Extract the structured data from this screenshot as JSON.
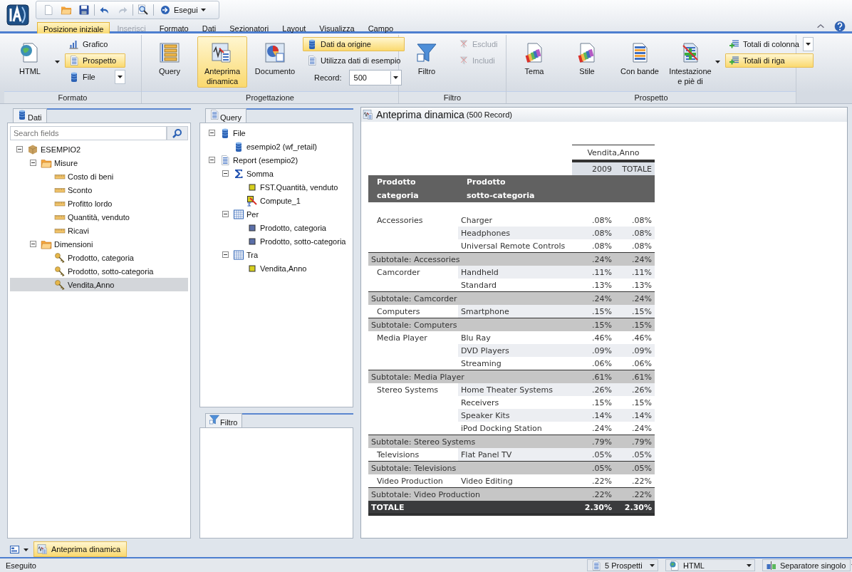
{
  "quick_toolbar": {
    "run_label": "Esegui"
  },
  "menu_tabs": [
    {
      "label": "Posizione iniziale",
      "selected": true,
      "disabled": false
    },
    {
      "label": "Inserisci",
      "selected": false,
      "disabled": true
    },
    {
      "label": "Formato",
      "selected": false,
      "disabled": false
    },
    {
      "label": "Dati",
      "selected": false,
      "disabled": false
    },
    {
      "label": "Sezionatori",
      "selected": false,
      "disabled": false
    },
    {
      "label": "Layout",
      "selected": false,
      "disabled": false
    },
    {
      "label": "Visualizza",
      "selected": false,
      "disabled": false
    },
    {
      "label": "Campo",
      "selected": false,
      "disabled": false
    }
  ],
  "ribbon": [
    {
      "label": "Formato",
      "items": [
        {
          "kind": "split_large",
          "label": "HTML",
          "selected": false,
          "disabled": false
        },
        {
          "kind": "stack",
          "items": [
            {
              "kind": "button",
              "label": "Grafico",
              "selected": false,
              "disabled": false
            },
            {
              "kind": "button",
              "label": "Prospetto",
              "selected": true,
              "disabled": false
            },
            {
              "kind": "split",
              "label": "File",
              "selected": false,
              "disabled": false
            }
          ]
        }
      ]
    },
    {
      "label": "Progettazione",
      "items": [
        {
          "kind": "large",
          "label": "Query",
          "selected": false,
          "disabled": false
        },
        {
          "kind": "large",
          "label": "Anteprima dinamica",
          "selected": true,
          "disabled": false
        },
        {
          "kind": "large",
          "label": "Documento",
          "selected": false,
          "disabled": false
        },
        {
          "kind": "stack",
          "items": [
            {
              "kind": "button",
              "label": "Dati da origine",
              "selected": true,
              "disabled": false
            },
            {
              "kind": "button",
              "label": "Utilizza dati di esempio",
              "selected": false,
              "disabled": false
            },
            {
              "kind": "field",
              "label": "Record:",
              "value": "500"
            }
          ]
        }
      ]
    },
    {
      "label": "Filtro",
      "items": [
        {
          "kind": "large",
          "label": "Filtro",
          "selected": false,
          "disabled": false
        },
        {
          "kind": "stack",
          "items": [
            {
              "kind": "button",
              "label": "Escludi",
              "selected": false,
              "disabled": true
            },
            {
              "kind": "button",
              "label": "Includi",
              "selected": false,
              "disabled": true
            }
          ]
        }
      ]
    },
    {
      "label": "Prospetto",
      "items": [
        {
          "kind": "large",
          "label": "Tema",
          "selected": false,
          "disabled": false
        },
        {
          "kind": "large",
          "label": "Stile",
          "selected": false,
          "disabled": false
        },
        {
          "kind": "large",
          "label": "Con bande",
          "selected": false,
          "disabled": false
        },
        {
          "kind": "split_large",
          "label": "Intestazione e piè di",
          "selected": false,
          "disabled": false
        },
        {
          "kind": "stack",
          "items": [
            {
              "kind": "split",
              "label": "Totali di colonna",
              "selected": false,
              "disabled": false
            },
            {
              "kind": "button",
              "label": "Totali di riga",
              "selected": true,
              "disabled": false
            }
          ]
        }
      ]
    }
  ],
  "data_panel": {
    "title": "Dati",
    "search": {
      "placeholder": "Search fields"
    },
    "tree": [
      {
        "kind": "cube",
        "label": "ESEMPIO2",
        "expanded": true,
        "selected": false,
        "children": [
          {
            "kind": "folder",
            "label": "Misure",
            "expanded": true,
            "selected": false,
            "children": [
              {
                "kind": "measure",
                "label": "Costo di beni",
                "selected": false
              },
              {
                "kind": "measure",
                "label": "Sconto",
                "selected": false
              },
              {
                "kind": "measure",
                "label": "Profitto lordo",
                "selected": false
              },
              {
                "kind": "measure",
                "label": "Quantità, venduto",
                "selected": false
              },
              {
                "kind": "measure",
                "label": "Ricavi",
                "selected": false
              }
            ]
          },
          {
            "kind": "folder",
            "label": "Dimensioni",
            "expanded": true,
            "selected": false,
            "children": [
              {
                "kind": "dimension",
                "label": "Prodotto, categoria",
                "selected": false
              },
              {
                "kind": "dimension",
                "label": "Prodotto, sotto-categoria",
                "selected": false
              },
              {
                "kind": "dimension",
                "label": "Vendita,Anno",
                "selected": true
              }
            ]
          }
        ]
      }
    ]
  },
  "query_panel": {
    "title": "Query",
    "tree": [
      {
        "kind": "database",
        "label": "File",
        "expanded": true,
        "children": [
          {
            "kind": "database",
            "label": "esempio2 (wf_retail)"
          }
        ]
      },
      {
        "kind": "report",
        "label": "Report (esempio2)",
        "expanded": true,
        "children": [
          {
            "kind": "sum",
            "label": "Somma",
            "expanded": true,
            "children": [
              {
                "kind": "field",
                "label": "FST.Quantità, venduto"
              },
              {
                "kind": "compute",
                "label": "Compute_1"
              }
            ]
          },
          {
            "kind": "grid",
            "label": "Per",
            "expanded": true,
            "children": [
              {
                "kind": "sort_field",
                "label": "Prodotto, categoria"
              },
              {
                "kind": "sort_field",
                "label": "Prodotto, sotto-categoria"
              }
            ]
          },
          {
            "kind": "grid",
            "label": "Tra",
            "expanded": true,
            "children": [
              {
                "kind": "field",
                "label": "Vendita,Anno"
              }
            ]
          }
        ]
      }
    ]
  },
  "filter_panel": {
    "title": "Filtro"
  },
  "preview": {
    "title": "Anteprima dinamica",
    "subtitle": "(500 Record)",
    "report": {
      "across_title": "Vendita,Anno",
      "across_columns": [
        "2009",
        "TOTALE"
      ],
      "row_headers": [
        [
          "Prodotto",
          "categoria"
        ],
        [
          "Prodotto",
          "sotto-categoria"
        ]
      ],
      "rows": [
        {
          "kind": "detail",
          "category": "Accessories",
          "subcategory": "Charger",
          "values": [
            ".08%",
            ".08%"
          ]
        },
        {
          "kind": "detail",
          "subcategory": "Headphones",
          "values": [
            ".08%",
            ".08%"
          ]
        },
        {
          "kind": "detail",
          "subcategory": "Universal Remote Controls",
          "values": [
            ".08%",
            ".08%"
          ]
        },
        {
          "kind": "subtotal",
          "label": "Subtotale: Accessories",
          "values": [
            ".24%",
            ".24%"
          ]
        },
        {
          "kind": "detail",
          "category": "Camcorder",
          "subcategory": "Handheld",
          "values": [
            ".11%",
            ".11%"
          ]
        },
        {
          "kind": "detail",
          "subcategory": "Standard",
          "values": [
            ".13%",
            ".13%"
          ]
        },
        {
          "kind": "subtotal",
          "label": "Subtotale: Camcorder",
          "values": [
            ".24%",
            ".24%"
          ]
        },
        {
          "kind": "detail",
          "category": "Computers",
          "subcategory": "Smartphone",
          "values": [
            ".15%",
            ".15%"
          ]
        },
        {
          "kind": "subtotal",
          "label": "Subtotale: Computers",
          "values": [
            ".15%",
            ".15%"
          ]
        },
        {
          "kind": "detail",
          "category": "Media Player",
          "subcategory": "Blu Ray",
          "values": [
            ".46%",
            ".46%"
          ]
        },
        {
          "kind": "detail",
          "subcategory": "DVD Players",
          "values": [
            ".09%",
            ".09%"
          ]
        },
        {
          "kind": "detail",
          "subcategory": "Streaming",
          "values": [
            ".06%",
            ".06%"
          ]
        },
        {
          "kind": "subtotal",
          "label": "Subtotale: Media Player",
          "values": [
            ".61%",
            ".61%"
          ]
        },
        {
          "kind": "detail",
          "category": "Stereo Systems",
          "subcategory": "Home Theater Systems",
          "values": [
            ".26%",
            ".26%"
          ]
        },
        {
          "kind": "detail",
          "subcategory": "Receivers",
          "values": [
            ".15%",
            ".15%"
          ]
        },
        {
          "kind": "detail",
          "subcategory": "Speaker Kits",
          "values": [
            ".14%",
            ".14%"
          ]
        },
        {
          "kind": "detail",
          "subcategory": "iPod Docking Station",
          "values": [
            ".24%",
            ".24%"
          ]
        },
        {
          "kind": "subtotal",
          "label": "Subtotale: Stereo Systems",
          "values": [
            ".79%",
            ".79%"
          ]
        },
        {
          "kind": "detail",
          "category": "Televisions",
          "subcategory": "Flat Panel TV",
          "values": [
            ".05%",
            ".05%"
          ]
        },
        {
          "kind": "subtotal",
          "label": "Subtotale: Televisions",
          "values": [
            ".05%",
            ".05%"
          ]
        },
        {
          "kind": "detail",
          "category": "Video Production",
          "subcategory": "Video Editing",
          "values": [
            ".22%",
            ".22%"
          ]
        },
        {
          "kind": "subtotal",
          "label": "Subtotale: Video Production",
          "values": [
            ".22%",
            ".22%"
          ]
        },
        {
          "kind": "total",
          "label": "TOTALE",
          "values": [
            "2.30%",
            "2.30%"
          ]
        }
      ]
    }
  },
  "bottom_tabs": [
    {
      "label": "Anteprima dinamica",
      "selected": true
    }
  ],
  "status_bar": {
    "message": "Eseguito",
    "dropdowns": [
      "5 Prospetti",
      "HTML",
      "Separatore singolo"
    ]
  }
}
